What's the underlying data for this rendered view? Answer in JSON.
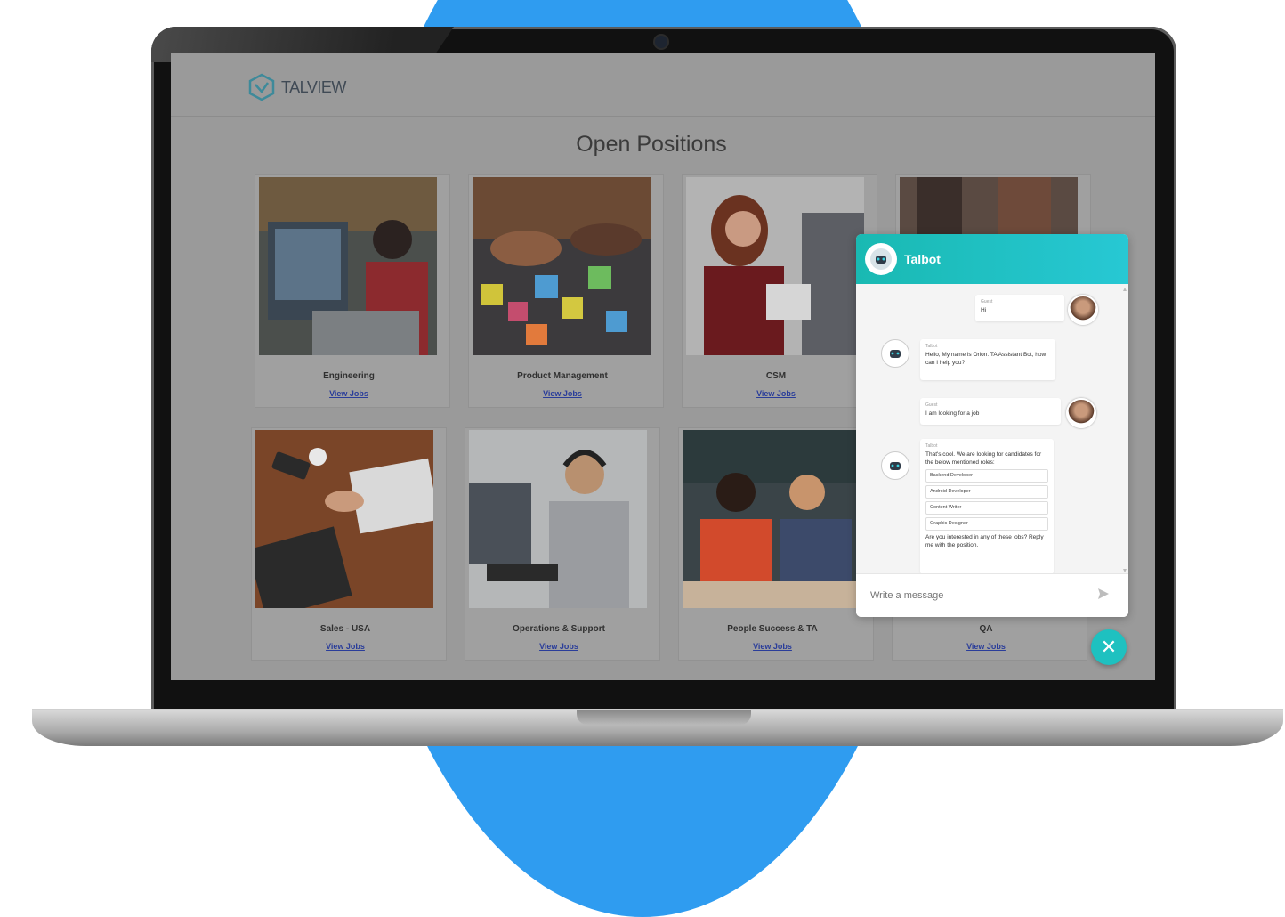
{
  "brand": {
    "name": "TALVIEW"
  },
  "page": {
    "title": "Open Positions"
  },
  "cards": [
    {
      "category": "Engineering",
      "link": "View Jobs"
    },
    {
      "category": "Product Management",
      "link": "View Jobs"
    },
    {
      "category": "CSM",
      "link": "View Jobs"
    },
    {
      "category": "",
      "link": ""
    },
    {
      "category": "Sales - USA",
      "link": "View Jobs"
    },
    {
      "category": "Operations & Support",
      "link": "View Jobs"
    },
    {
      "category": "People Success & TA",
      "link": "View Jobs"
    },
    {
      "category": "QA",
      "link": "View Jobs"
    }
  ],
  "chat": {
    "title": "Talbot",
    "messages": [
      {
        "from": "user",
        "who": "Guest",
        "text": "Hi"
      },
      {
        "from": "bot",
        "who": "Talbot",
        "text": "Hello, My name is Orion. TA Assistant Bot, how can I help you?"
      },
      {
        "from": "user",
        "who": "Guest",
        "text": "I am looking for a job"
      },
      {
        "from": "bot",
        "who": "Talbot",
        "text": "That's cool. We are looking for candidates for the below mentioned roles:"
      }
    ],
    "options": [
      "Backend Developer",
      "Android Developer",
      "Content Writer",
      "Graphic Designer"
    ],
    "follow_up": "Are you interested in any of these jobs? Reply me with the position.",
    "input_placeholder": "Write a message"
  },
  "colors": {
    "backdrop": "#2f9cf0",
    "chat_header": "#19b9b2",
    "screen_overlay": "#9a9a9a"
  }
}
